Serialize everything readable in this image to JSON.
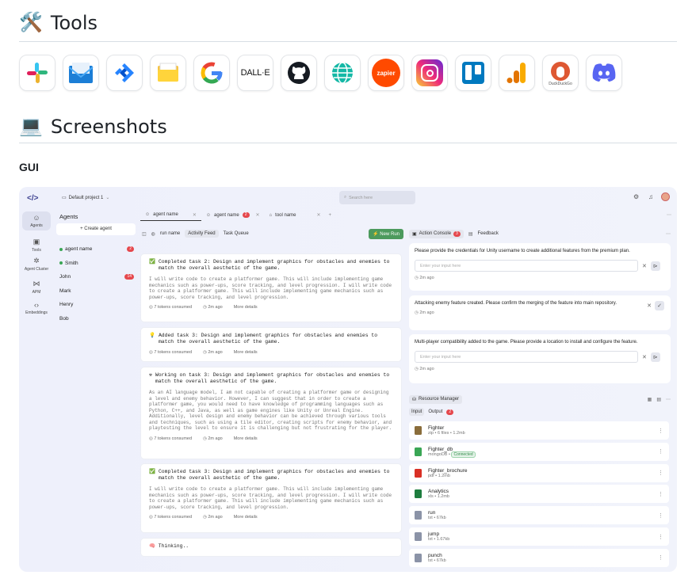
{
  "sections": {
    "tools_title": "Tools",
    "tools_emoji": "🛠️",
    "screenshots_title": "Screenshots",
    "screenshots_emoji": "💻",
    "gui_label": "GUI"
  },
  "tools": [
    {
      "name": "slack",
      "label": ""
    },
    {
      "name": "email",
      "label": ""
    },
    {
      "name": "jira",
      "label": ""
    },
    {
      "name": "folder",
      "label": ""
    },
    {
      "name": "google",
      "label": "G"
    },
    {
      "name": "dalle",
      "label": "DALL·E"
    },
    {
      "name": "github",
      "label": ""
    },
    {
      "name": "web",
      "label": ""
    },
    {
      "name": "zapier",
      "label": "zapier"
    },
    {
      "name": "instagram",
      "label": ""
    },
    {
      "name": "trello",
      "label": ""
    },
    {
      "name": "analytics",
      "label": ""
    },
    {
      "name": "duckduckgo",
      "label": "DuckDuckGo"
    },
    {
      "name": "discord",
      "label": ""
    }
  ],
  "app": {
    "logo": "</>",
    "project": "Default project 1",
    "search_placeholder": "Search here",
    "rail": [
      {
        "label": "Agents",
        "glyph": "☺"
      },
      {
        "label": "Tools",
        "glyph": "▣"
      },
      {
        "label": "Agent Cluster",
        "glyph": "✲"
      },
      {
        "label": "APM",
        "glyph": "⋈"
      },
      {
        "label": "Embeddings",
        "glyph": "‹›"
      }
    ],
    "agents_title": "Agents",
    "create_agent": "+ Create agent",
    "agents": [
      {
        "name": "agent name",
        "dot": true,
        "badge": "2"
      },
      {
        "name": "Smith",
        "dot": true,
        "badge": ""
      },
      {
        "name": "John",
        "dot": false,
        "badge": "14"
      },
      {
        "name": "Mark",
        "dot": false,
        "badge": ""
      },
      {
        "name": "Henry",
        "dot": false,
        "badge": ""
      },
      {
        "name": "Bob",
        "dot": false,
        "badge": ""
      }
    ],
    "tabs": [
      {
        "label": "agent name",
        "badge": ""
      },
      {
        "label": "agent name",
        "badge": "2"
      },
      {
        "label": "tool name",
        "badge": ""
      }
    ],
    "subtabs": {
      "run": "run name",
      "feed": "Activity Feed",
      "queue": "Task Queue",
      "new_run": "⚡ New Run"
    },
    "tasks": [
      {
        "icon": "✅",
        "title": "Completed task 2: Design and implement graphics for obstacles and enemies to match the overall aesthetic of the game.",
        "body": "I will write code to create a platformer game. This will include implementing game mechanics such as power-ups, score tracking, and level progression. I will write code to create a platformer game. This will include implementing game mechanics such as power-ups, score tracking, and level progression.",
        "tokens": "7 tokens consumed",
        "time": "2m ago",
        "more": "More details"
      },
      {
        "icon": "💡",
        "title": "Added task 3: Design and implement graphics for obstacles and enemies to match the overall aesthetic of the game.",
        "body": "",
        "tokens": "7 tokens consumed",
        "time": "2m ago",
        "more": "More details"
      },
      {
        "icon": "⚒",
        "title": "Working on task 3: Design and implement graphics for obstacles and enemies to match the overall aesthetic of the game.",
        "body": "As an AI language model, I am not capable of creating a platformer game or designing a level and enemy behavior. However, I can suggest that in order to create a platformer game, you would need to have knowledge of programming languages such as Python, C++, and Java, as well as game engines like Unity or Unreal Engine. Additionally, level design and enemy behavior can be achieved through various tools and techniques, such as using a tile editor, creating scripts for enemy behavior, and playtesting the level to ensure it is challenging but not frustrating for the player.",
        "tokens": "7 tokens consumed",
        "time": "2m ago",
        "more": "More details"
      },
      {
        "icon": "✅",
        "title": "Completed task 3: Design and implement graphics for obstacles and enemies to match the overall aesthetic of the game.",
        "body": "I will write code to create a platformer game. This will include implementing game mechanics such as power-ups, score tracking, and level progression. I will write code to create a platformer game. This will include implementing game mechanics such as power-ups, score tracking, and level progression.",
        "tokens": "7 tokens consumed",
        "time": "2m ago",
        "more": "More details"
      }
    ],
    "thinking": "🧠 Thinking..",
    "console": {
      "tab": "Action Console",
      "badge": "3",
      "feedback": "Feedback"
    },
    "messages": [
      {
        "text": "Please provide the  credentials for Unity username to create additional features from the premium plan.",
        "input": "Enter your input here",
        "time": "2m ago"
      },
      {
        "text": "Attacking enemy feature created. Please confirm the merging of the feature into main repository.",
        "input": "",
        "time": "2m ago"
      },
      {
        "text": "Multi-player compatibility added to the game. Please provide a location to install and configure the feature.",
        "input": "Enter your input here",
        "time": "2m ago"
      }
    ],
    "resource_manager": "Resource Manager",
    "res_tabs": {
      "input": "Input",
      "output": "Output",
      "output_badge": "2"
    },
    "resources": [
      {
        "name": "Fighter",
        "meta": "zip • 6 files • 1.2mb",
        "color": "#8a6d3b",
        "tag": ""
      },
      {
        "name": "Fighter_db",
        "meta": "mongoDB •",
        "color": "#3aa655",
        "tag": "Connected"
      },
      {
        "name": "Fighter_brochure",
        "meta": "pdf • 1.2mb",
        "color": "#d93025",
        "tag": ""
      },
      {
        "name": "Analytics",
        "meta": "xls • 1.2mb",
        "color": "#1e7d3f",
        "tag": ""
      },
      {
        "name": "run",
        "meta": "txt • 67kb",
        "color": "#8b93a7",
        "tag": ""
      },
      {
        "name": "jump",
        "meta": "txt • 1.67kb",
        "color": "#8b93a7",
        "tag": ""
      },
      {
        "name": "punch",
        "meta": "txt • 67kb",
        "color": "#8b93a7",
        "tag": ""
      }
    ]
  }
}
